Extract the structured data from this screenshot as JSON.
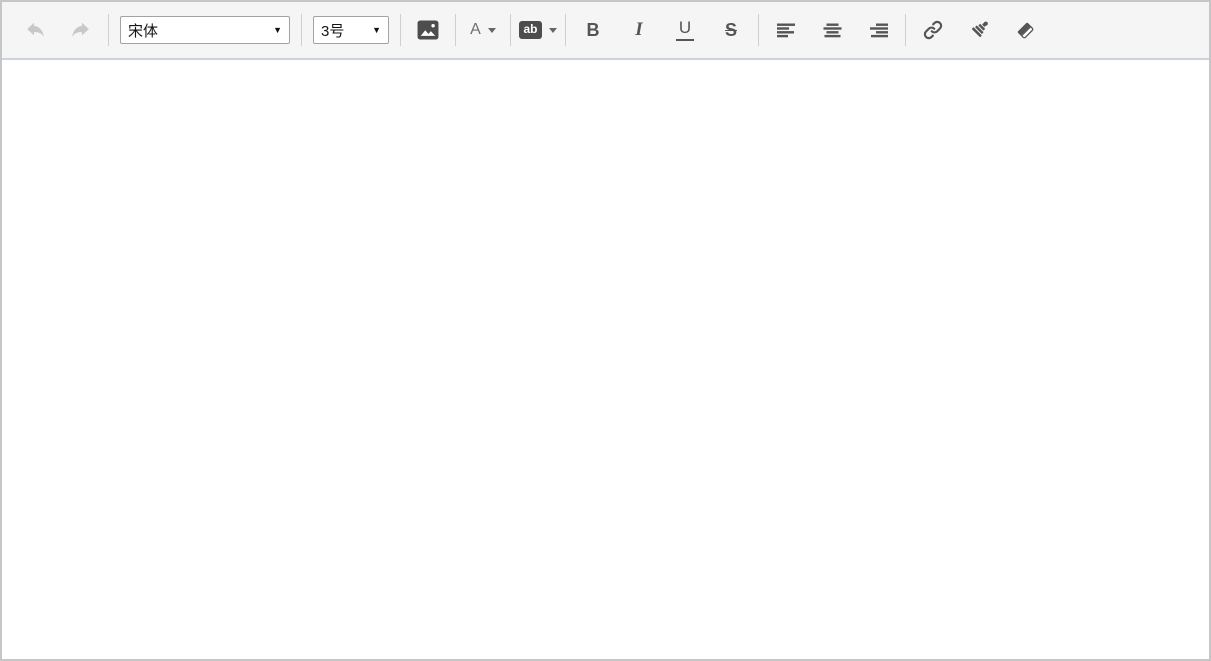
{
  "toolbar": {
    "undo_tooltip": "undo",
    "redo_tooltip": "redo",
    "font_family_value": "宋体",
    "font_size_value": "3号",
    "select_caret": "▼",
    "font_color_label": "A",
    "highlight_label": "ab",
    "bold_label": "B",
    "italic_label": "I",
    "underline_label": "U",
    "strikethrough_label": "S",
    "icons": [
      "undo-icon",
      "redo-icon",
      "image-icon",
      "font-color-caret-icon",
      "highlight-caret-icon",
      "align-left-icon",
      "align-center-icon",
      "align-right-icon",
      "link-icon",
      "brush-icon",
      "eraser-icon"
    ]
  },
  "editor": {
    "content": ""
  },
  "colors": {
    "toolbar_bg": "#f5f5f5",
    "outer_border": "#c6c6c6",
    "toolbar_divider": "#cfcfcf",
    "toolbar_bottom_border": "#ccd3dc",
    "icon_color": "#555555",
    "disabled_icon_color": "#c8c8c8",
    "badge_bg": "#4d4d4d",
    "content_bg": "#ffffff"
  }
}
